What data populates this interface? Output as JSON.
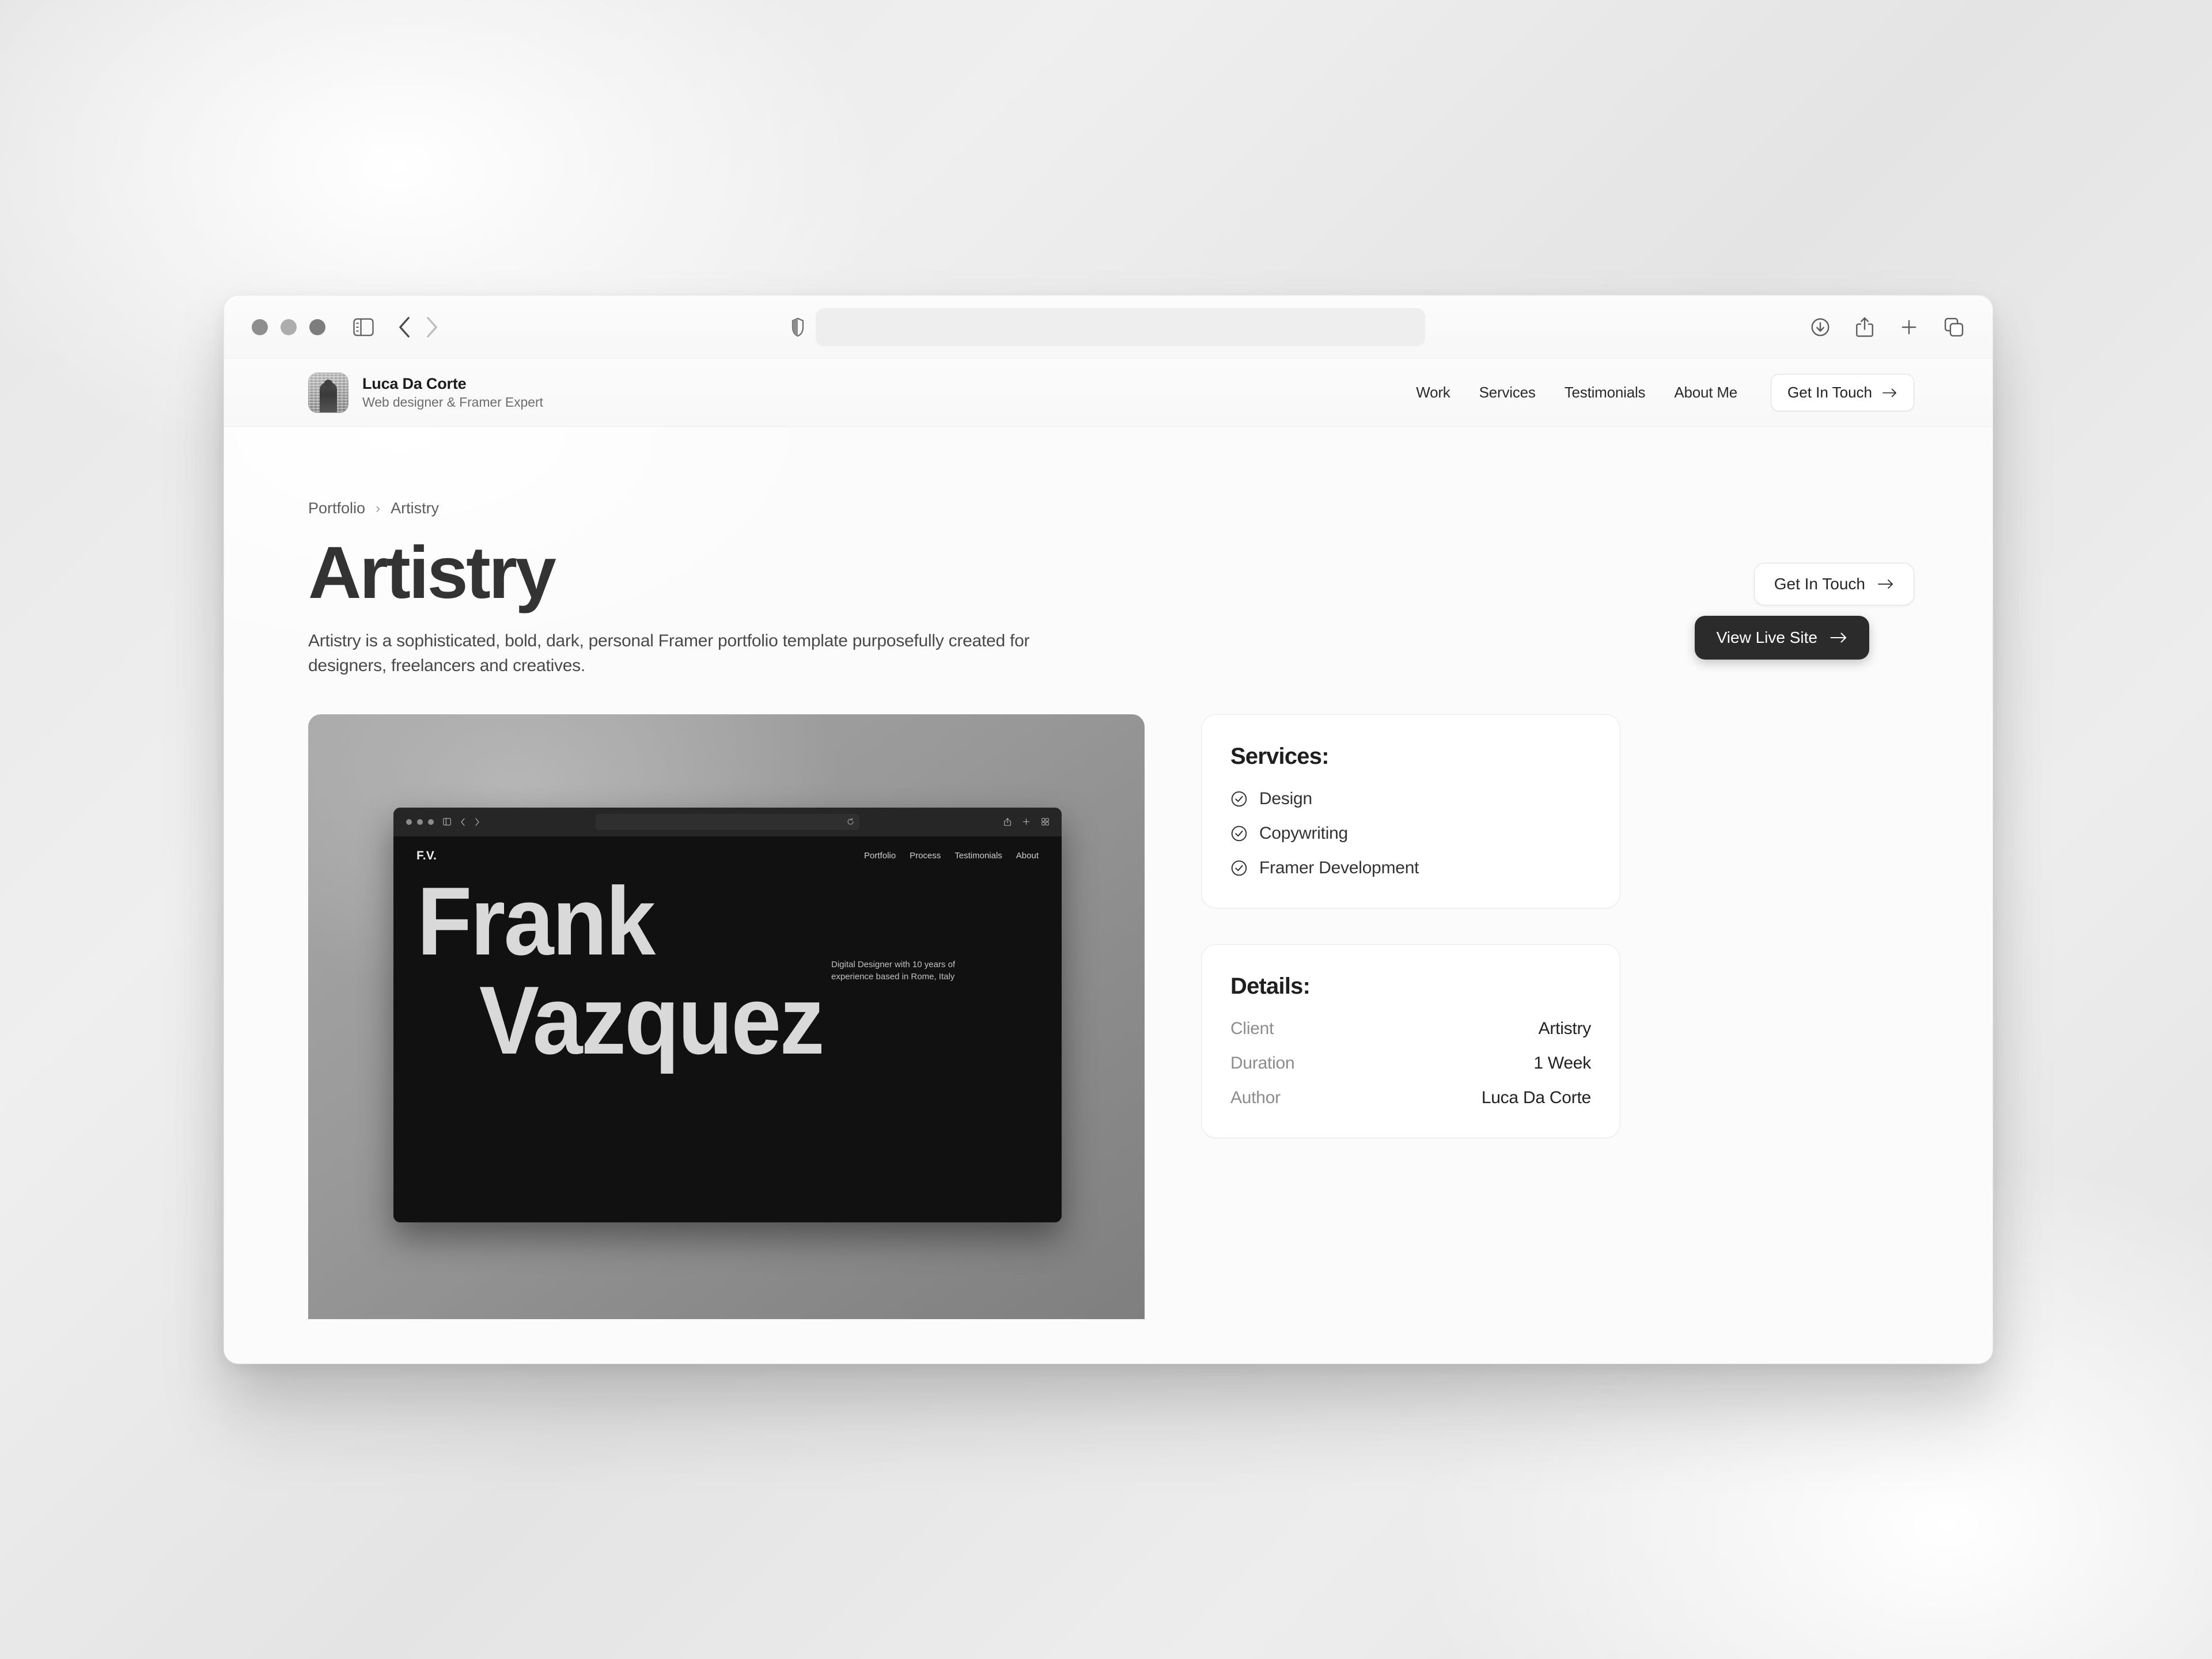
{
  "browser": {
    "traffic_lights": [
      "close-dot",
      "minimize-dot",
      "zoom-dot"
    ],
    "sidebar_icon": "sidebar-toggle-icon",
    "back_icon": "chevron-left-icon",
    "forward_icon": "chevron-right-icon",
    "shield_icon": "privacy-shield-icon",
    "address_value": "",
    "address_placeholder": "",
    "reload_icon": "reload-icon",
    "downloads_icon": "download-icon",
    "share_icon": "share-icon",
    "new_tab_icon": "plus-icon",
    "tab_overview_icon": "tab-overview-icon"
  },
  "site_header": {
    "brand_name": "Luca Da Corte",
    "brand_role": "Web designer & Framer Expert",
    "avatar_icon": "profile-avatar",
    "nav": [
      {
        "label": "Work"
      },
      {
        "label": "Services"
      },
      {
        "label": "Testimonials"
      },
      {
        "label": "About Me"
      }
    ],
    "cta_label": "Get In Touch",
    "cta_arrow": "arrow-right-icon"
  },
  "main": {
    "breadcrumb": {
      "root": "Portfolio",
      "separator": "›",
      "current": "Artistry"
    },
    "title": "Artistry",
    "description": "Artistry is a sophisticated, bold, dark, personal Framer portfolio template purposefully created for designers, freelancers and creatives.",
    "cta_secondary": "Get In Touch",
    "cta_primary": "View Live Site",
    "arrow_icon": "arrow-right-icon"
  },
  "mockup": {
    "traffic_lights": [
      "close-dot",
      "minimize-dot",
      "zoom-dot"
    ],
    "sidebar_icon": "sidebar-toggle-icon",
    "back_icon": "chevron-left-icon",
    "forward_icon": "chevron-right-icon",
    "reload_icon": "reload-icon",
    "share_icon": "share-icon",
    "new_tab_icon": "plus-icon",
    "tab_overview_icon": "tab-overview-icon",
    "logo": "F.V.",
    "nav": [
      {
        "label": "Portfolio"
      },
      {
        "label": "Process"
      },
      {
        "label": "Testimonials"
      },
      {
        "label": "About"
      }
    ],
    "hero_line1": "Frank",
    "hero_line2": "Vazquez",
    "hero_subtitle": "Digital Designer with 10 years of experience based in Rome, Italy"
  },
  "services_card": {
    "title": "Services:",
    "check_icon": "circle-check-icon",
    "items": [
      {
        "label": "Design"
      },
      {
        "label": "Copywriting"
      },
      {
        "label": "Framer Development"
      }
    ]
  },
  "details_card": {
    "title": "Details:",
    "rows": [
      {
        "key": "Client",
        "value": "Artistry"
      },
      {
        "key": "Duration",
        "value": "1 Week"
      },
      {
        "key": "Author",
        "value": "Luca Da Corte"
      }
    ]
  },
  "colors": {
    "page_bg": "#fbfbfb",
    "title": "#333333",
    "cta_primary_bg": "#2b2b2b",
    "mock_bg": "#111111",
    "media_gradient_from": "#a7a7a7",
    "media_gradient_to": "#7f7f7f"
  }
}
